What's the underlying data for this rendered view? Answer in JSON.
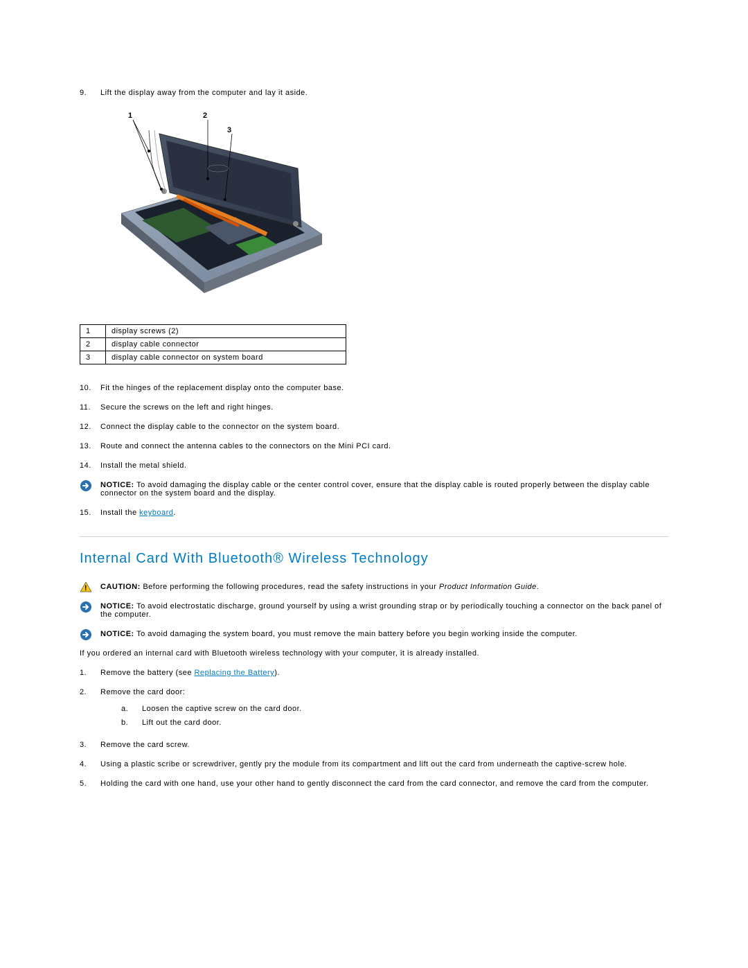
{
  "top_step": {
    "num": "9.",
    "text": "Lift the display away from the computer and lay it aside."
  },
  "diagram": {
    "callouts": [
      "1",
      "2",
      "3"
    ]
  },
  "legend": {
    "rows": [
      {
        "num": "1",
        "text": "display screws (2)"
      },
      {
        "num": "2",
        "text": "display cable connector"
      },
      {
        "num": "3",
        "text": "display cable connector on system board"
      }
    ]
  },
  "steps_after": [
    {
      "num": "10.",
      "text": "Fit the hinges of the replacement display onto the computer base."
    },
    {
      "num": "11.",
      "text": "Secure the screws on the left and right hinges."
    },
    {
      "num": "12.",
      "text": "Connect the display cable to the connector on the system board."
    },
    {
      "num": "13.",
      "text": "Route and connect the antenna cables to the connectors on the Mini PCI card."
    },
    {
      "num": "14.",
      "text": "Install the metal shield."
    }
  ],
  "notice_display": {
    "label": "NOTICE:",
    "text": " To avoid damaging the display cable or the center control cover, ensure that the display cable is routed properly between the display cable connector on the system board and the display."
  },
  "step15": {
    "num": "15.",
    "prefix": "Install the ",
    "link": "keyboard",
    "suffix": "."
  },
  "section_heading": "Internal Card With Bluetooth® Wireless Technology",
  "caution": {
    "label": "CAUTION:",
    "text_prefix": " Before performing the following procedures, read the safety instructions in your ",
    "text_italic": "Product Information Guide",
    "text_suffix": "."
  },
  "notice_esd": {
    "label": "NOTICE:",
    "text": " To avoid electrostatic discharge, ground yourself by using a wrist grounding strap or by periodically touching a connector on the back panel of the computer."
  },
  "notice_battery": {
    "label": "NOTICE:",
    "text": " To avoid damaging the system board, you must remove the main battery before you begin working inside the computer."
  },
  "intro_bt": "If you ordered an internal card with Bluetooth wireless technology with your computer, it is already installed.",
  "bt_steps": {
    "step1": {
      "num": "1.",
      "prefix": "Remove the battery (see ",
      "link": "Replacing the Battery",
      "suffix": ")."
    },
    "step2": {
      "num": "2.",
      "text": "Remove the card door:",
      "subs": [
        {
          "letter": "a.",
          "text": "Loosen the captive screw on the card door."
        },
        {
          "letter": "b.",
          "text": "Lift out the card door."
        }
      ]
    },
    "step3": {
      "num": "3.",
      "text": "Remove the card screw."
    },
    "step4": {
      "num": "4.",
      "text": "Using a plastic scribe or screwdriver, gently pry the module from its compartment and lift out the card from underneath the captive-screw hole."
    },
    "step5": {
      "num": "5.",
      "text": "Holding the card with one hand, use your other hand to gently disconnect the card from the card connector, and remove the card from the computer."
    }
  }
}
